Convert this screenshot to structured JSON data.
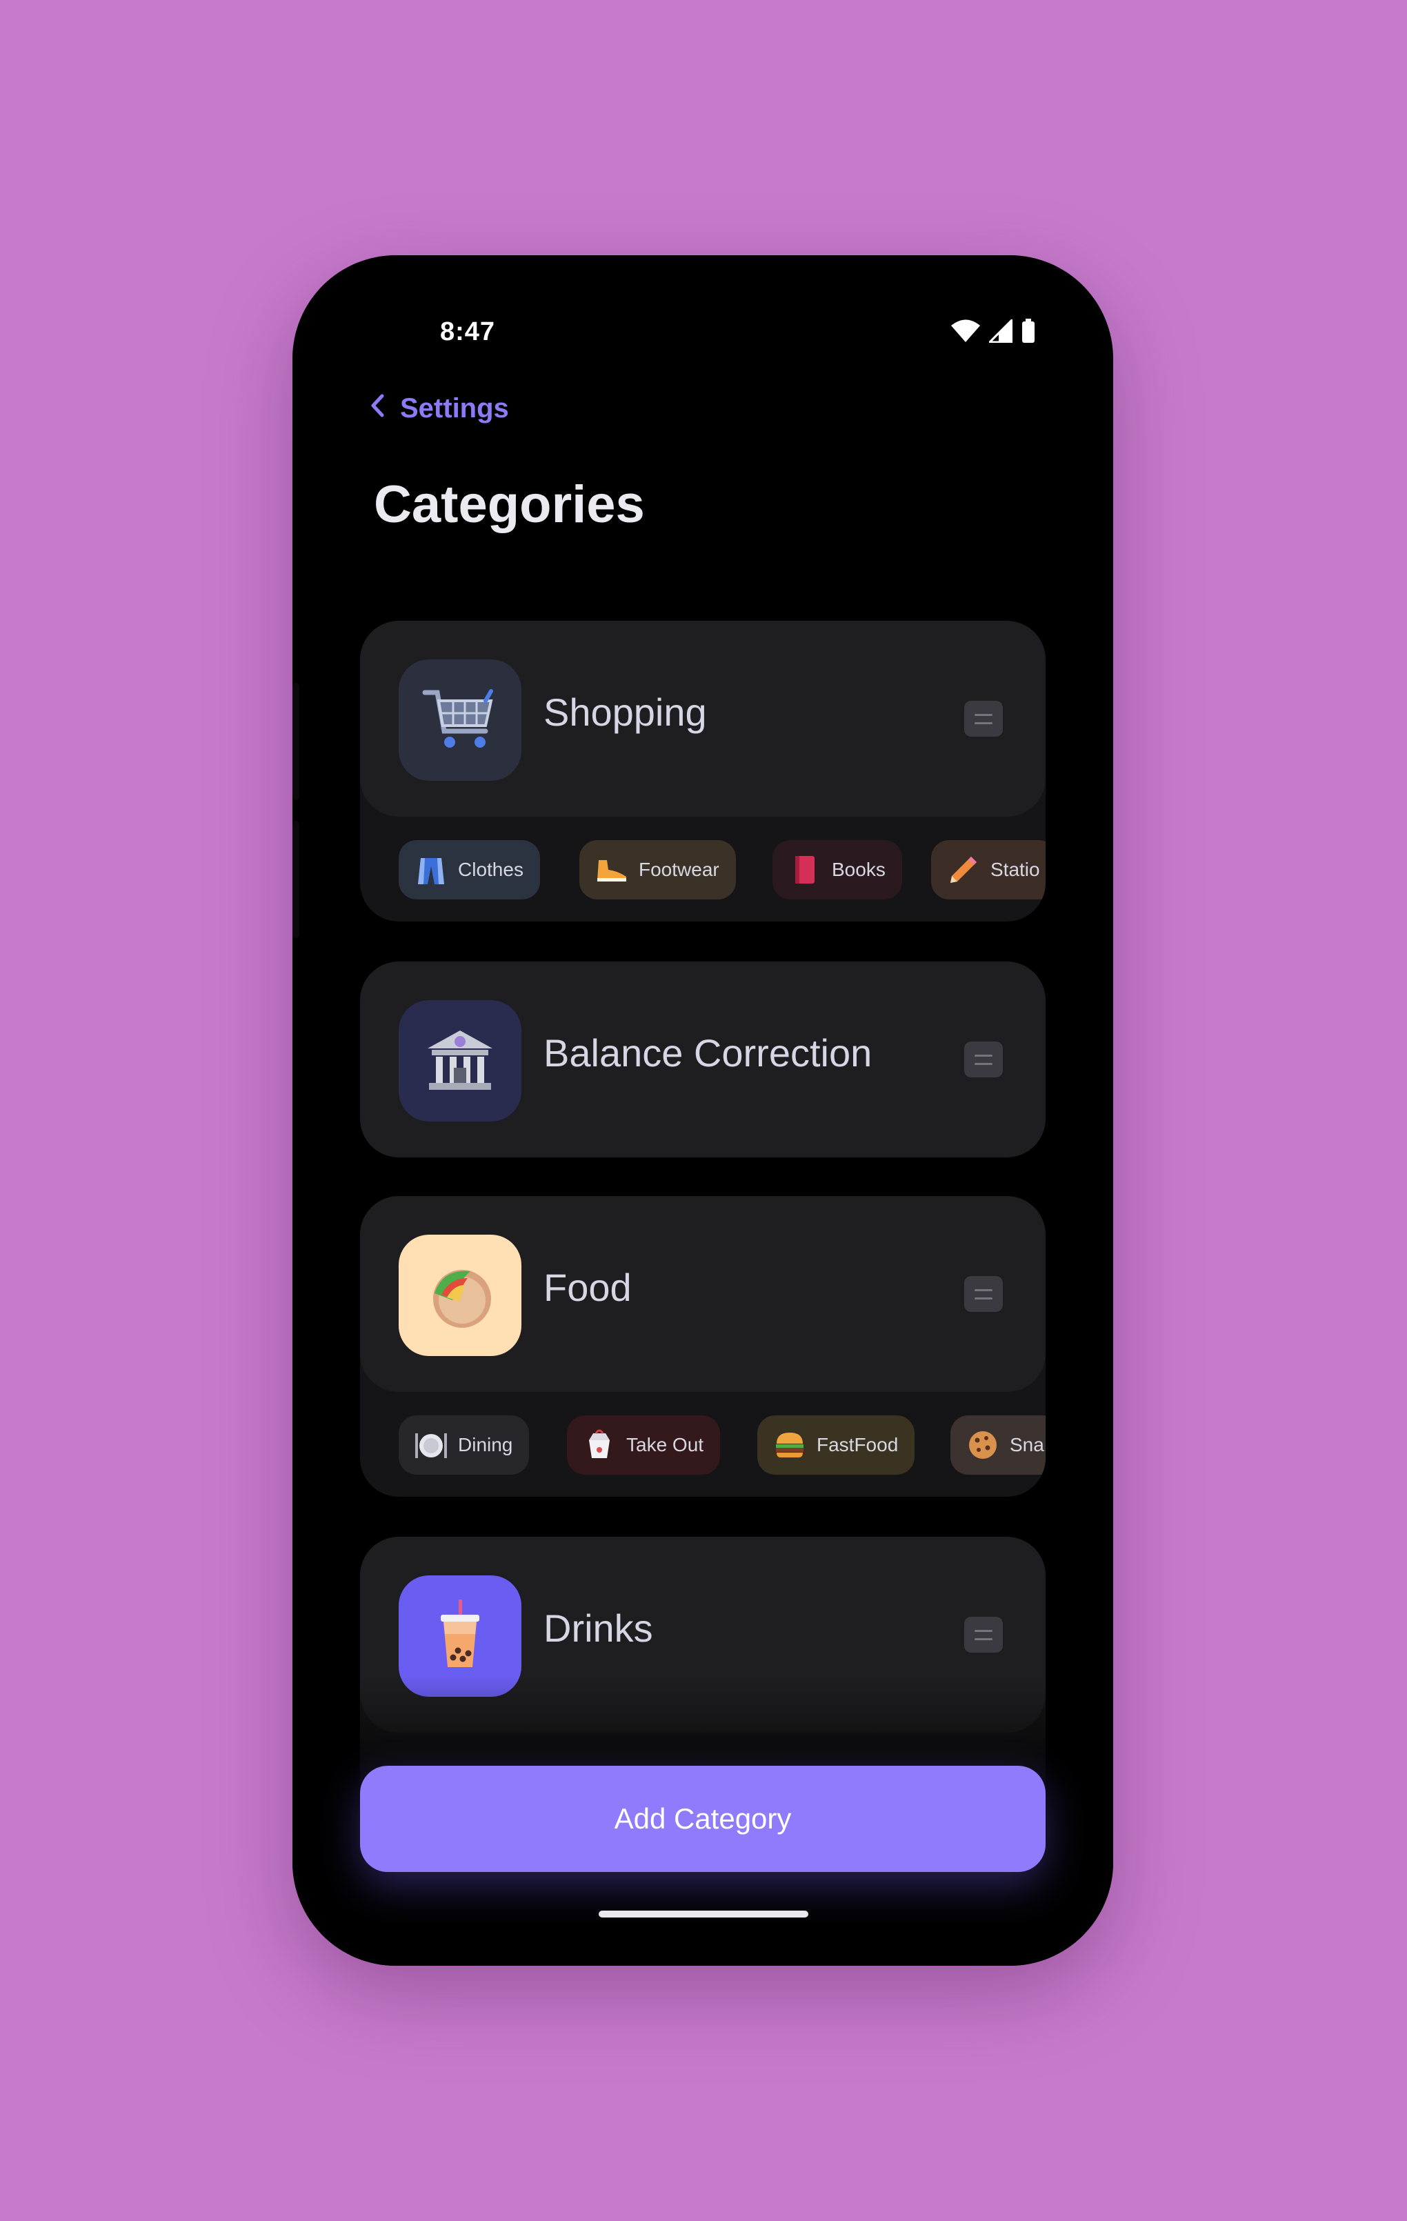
{
  "status_bar": {
    "time": "8:47"
  },
  "nav": {
    "back_label": "Settings"
  },
  "page": {
    "title": "Categories"
  },
  "categories": [
    {
      "name": "Shopping",
      "icon": "shopping-cart-icon",
      "subcategories": [
        {
          "label": "Clothes",
          "icon": "clothes-icon"
        },
        {
          "label": "Footwear",
          "icon": "shoe-icon"
        },
        {
          "label": "Books",
          "icon": "book-icon"
        },
        {
          "label": "Statio",
          "icon": "pencil-icon"
        }
      ]
    },
    {
      "name": "Balance Correction",
      "icon": "bank-icon",
      "subcategories": []
    },
    {
      "name": "Food",
      "icon": "taco-icon",
      "subcategories": [
        {
          "label": "Dining",
          "icon": "plate-icon"
        },
        {
          "label": "Take Out",
          "icon": "takeout-box-icon"
        },
        {
          "label": "FastFood",
          "icon": "burger-icon"
        },
        {
          "label": "Sna",
          "icon": "cookie-icon"
        }
      ]
    },
    {
      "name": "Drinks",
      "icon": "bubble-tea-icon",
      "subcategories": []
    }
  ],
  "actions": {
    "add_label": "Add Category"
  },
  "colors": {
    "background": "#c67bca",
    "accent": "#8f7bfc",
    "card": "#1e1e20",
    "text": "#d6d6e4"
  }
}
